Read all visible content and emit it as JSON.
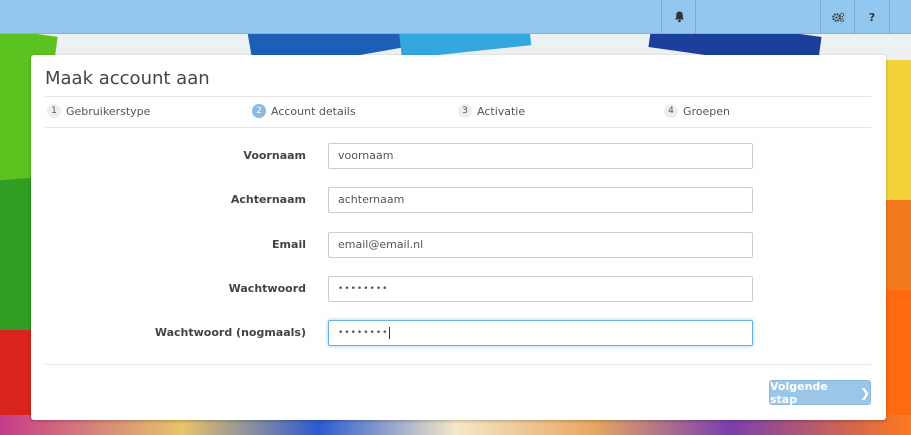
{
  "topbar": {
    "bell_icon": "bell-icon",
    "settings_icon": "gears-icon",
    "help_label": "?"
  },
  "form": {
    "title": "Maak account aan",
    "steps": [
      {
        "num": "1",
        "label": "Gebruikerstype",
        "active": false
      },
      {
        "num": "2",
        "label": "Account details",
        "active": true
      },
      {
        "num": "3",
        "label": "Activatie",
        "active": false
      },
      {
        "num": "4",
        "label": "Groepen",
        "active": false
      }
    ],
    "fields": {
      "voornaam": {
        "label": "Voornaam",
        "value": "voornaam"
      },
      "achternaam": {
        "label": "Achternaam",
        "value": "achternaam"
      },
      "email": {
        "label": "Email",
        "value": "email@email.nl"
      },
      "wachtwoord": {
        "label": "Wachtwoord",
        "value": "••••••••"
      },
      "wachtwoord2": {
        "label": "Wachtwoord (nogmaals)",
        "value": "••••••••"
      }
    },
    "next_label": "Volgende stap"
  },
  "colors": {
    "topbar": "#92c8ef",
    "accent": "#8ab9e2",
    "button": "#9bc6e8"
  }
}
